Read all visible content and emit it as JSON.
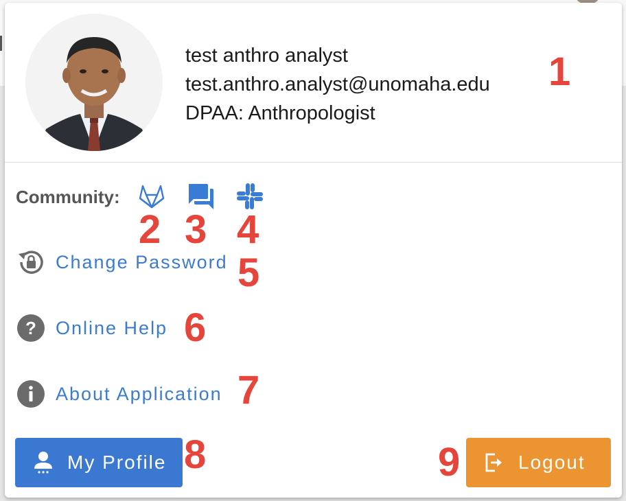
{
  "user": {
    "name": "test anthro analyst",
    "email": "test.anthro.analyst@unomaha.edu",
    "role": "DPAA: Anthropologist"
  },
  "community": {
    "label": "Community:",
    "icons": [
      "gitlab-icon",
      "forum-icon",
      "slack-icon"
    ]
  },
  "menu": {
    "change_password": "Change Password",
    "online_help": "Online Help",
    "about_application": "About Application"
  },
  "buttons": {
    "my_profile": "My Profile",
    "logout": "Logout"
  },
  "callouts": [
    "1",
    "2",
    "3",
    "4",
    "5",
    "6",
    "7",
    "8",
    "9"
  ],
  "colors": {
    "link": "#3a7bd5",
    "primary_button": "#3a78d1",
    "logout_button": "#ec9432",
    "callout": "#e5453b",
    "icon_gray": "#6b6b6b"
  }
}
